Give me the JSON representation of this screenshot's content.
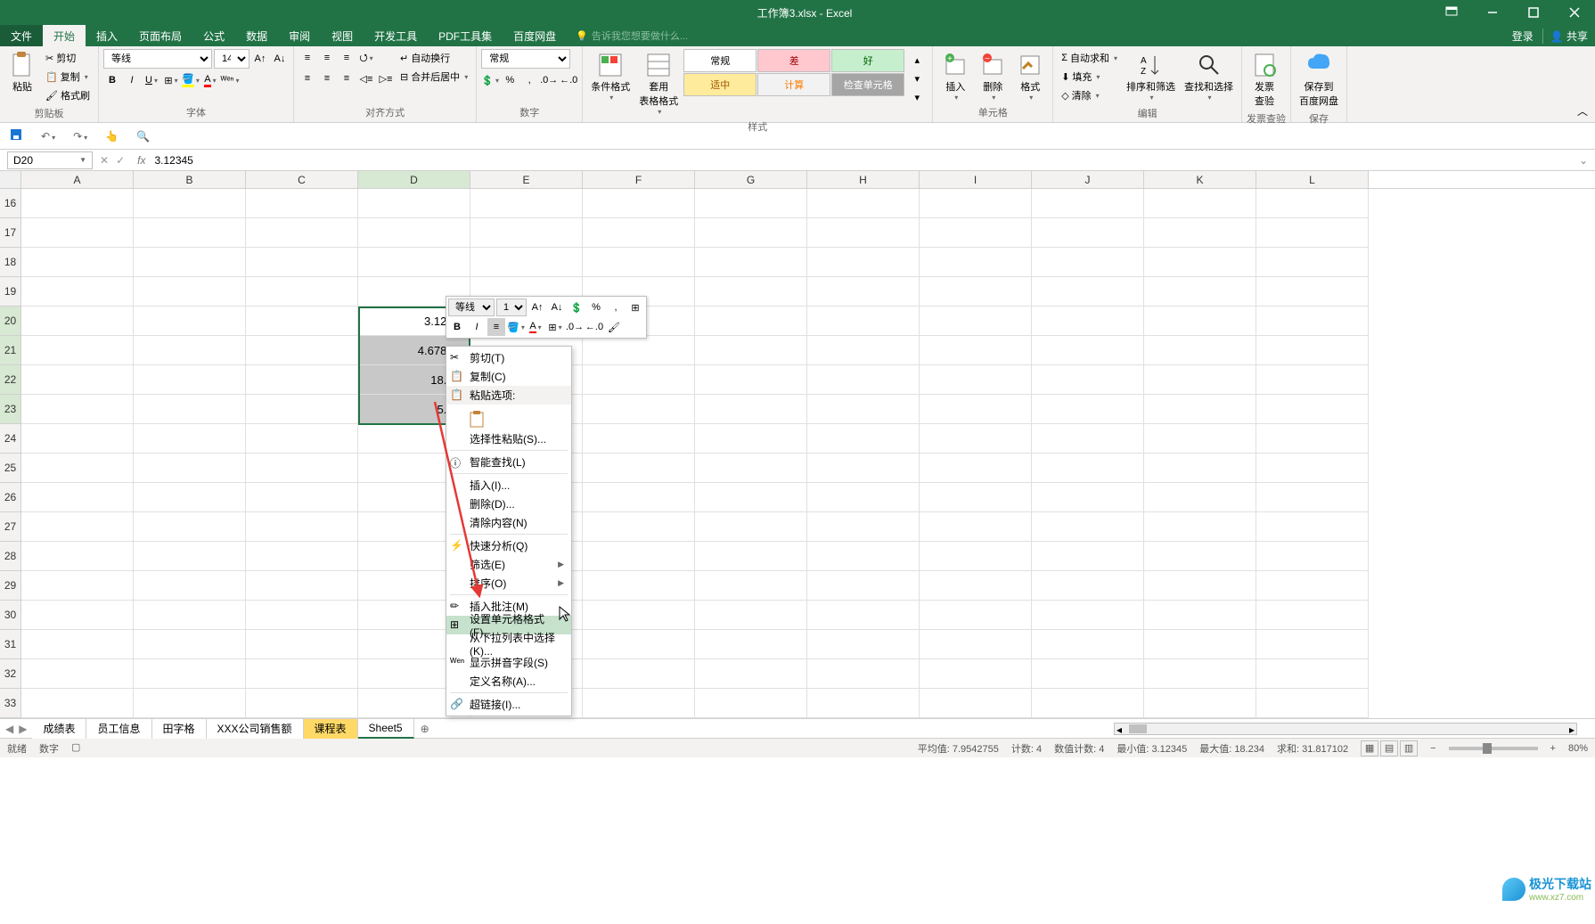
{
  "title": "工作簿3.xlsx - Excel",
  "menubar": {
    "file": "文件",
    "tabs": [
      "开始",
      "插入",
      "页面布局",
      "公式",
      "数据",
      "审阅",
      "视图",
      "开发工具",
      "PDF工具集",
      "百度网盘"
    ],
    "tellme": "告诉我您想要做什么...",
    "login": "登录",
    "share": "共享"
  },
  "ribbon": {
    "clipboard": {
      "label": "剪贴板",
      "paste": "粘贴",
      "cut": "剪切",
      "copy": "复制",
      "format_painter": "格式刷"
    },
    "font": {
      "label": "字体",
      "font_name": "等线",
      "font_size": "14"
    },
    "alignment": {
      "label": "对齐方式",
      "wrap": "自动换行",
      "merge": "合并后居中"
    },
    "number": {
      "label": "数字",
      "format": "常规"
    },
    "styles": {
      "label": "样式",
      "cond_format": "条件格式",
      "table_format": "套用\n表格格式",
      "gallery": {
        "normal": "常规",
        "bad": "差",
        "good": "好",
        "neutral": "适中",
        "calc": "计算",
        "check": "检查单元格"
      }
    },
    "cells": {
      "label": "单元格",
      "insert": "插入",
      "delete": "删除",
      "format": "格式"
    },
    "editing": {
      "label": "编辑",
      "autosum": "自动求和",
      "fill": "填充",
      "clear": "清除",
      "sort": "排序和筛选",
      "find": "查找和选择"
    },
    "invoice": {
      "label": "发票查验",
      "btn": "发票\n查验"
    },
    "save": {
      "label": "保存",
      "btn": "保存到\n百度网盘"
    }
  },
  "formula_bar": {
    "cell_ref": "D20",
    "value": "3.12345"
  },
  "columns": [
    "A",
    "B",
    "C",
    "D",
    "E",
    "F",
    "G",
    "H",
    "I",
    "J",
    "K",
    "L"
  ],
  "rows": [
    16,
    17,
    18,
    19,
    20,
    21,
    22,
    23,
    24,
    25,
    26,
    27,
    28,
    29,
    30,
    31,
    32,
    33
  ],
  "cell_data": {
    "D20": "3.12345",
    "D21": "4.678652",
    "D22": "18.234",
    "D23": "5.781"
  },
  "mini_toolbar": {
    "font": "等线",
    "size": "14"
  },
  "context_menu": {
    "cut": "剪切(T)",
    "copy": "复制(C)",
    "paste_opts": "粘贴选项:",
    "paste_special": "选择性粘贴(S)...",
    "smart_lookup": "智能查找(L)",
    "insert": "插入(I)...",
    "delete": "删除(D)...",
    "clear": "清除内容(N)",
    "quick_analysis": "快速分析(Q)",
    "filter": "筛选(E)",
    "sort": "排序(O)",
    "insert_comment": "插入批注(M)",
    "format_cells": "设置单元格格式(F)...",
    "from_dropdown": "从下拉列表中选择(K)...",
    "show_pinyin": "显示拼音字段(S)",
    "define_name": "定义名称(A)...",
    "hyperlink": "超链接(I)..."
  },
  "sheet_tabs": {
    "tabs": [
      "成绩表",
      "员工信息",
      "田字格",
      "XXX公司销售额",
      "课程表",
      "Sheet5"
    ],
    "active": "Sheet5",
    "colored": "课程表"
  },
  "statusbar": {
    "ready": "就绪",
    "mode": "数字",
    "avg": "平均值: 7.9542755",
    "count": "计数: 4",
    "num_count": "数值计数: 4",
    "min": "最小值: 3.12345",
    "max": "最大值: 18.234",
    "sum": "求和: 31.817102",
    "zoom": "80%"
  },
  "watermark": {
    "name": "极光下载站",
    "url": "www.xz7.com"
  }
}
